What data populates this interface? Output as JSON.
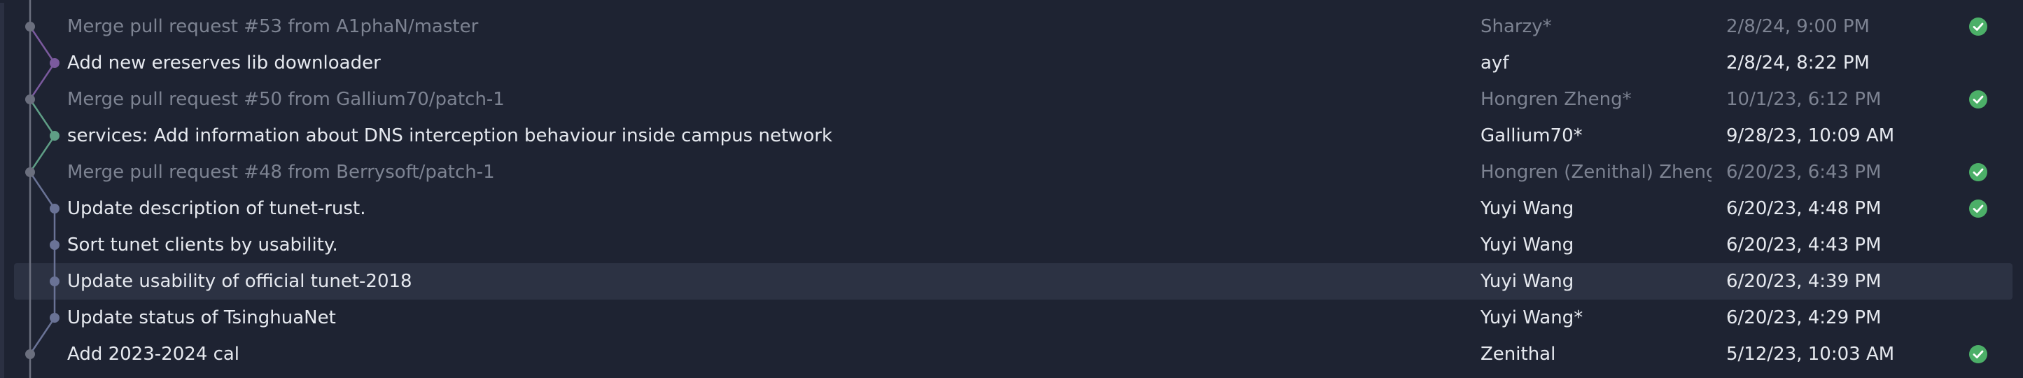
{
  "commits": [
    {
      "message": "Merge pull request #53 from A1phaN/master",
      "author": "Sharzy*",
      "date": "2/8/24, 9:00 PM",
      "status": "success",
      "merge": true
    },
    {
      "message": "Add new ereserves lib downloader",
      "author": "ayf",
      "date": "2/8/24, 8:22 PM",
      "status": "none",
      "merge": false
    },
    {
      "message": "Merge pull request #50 from Gallium70/patch-1",
      "author": "Hongren Zheng*",
      "date": "10/1/23, 6:12 PM",
      "status": "success",
      "merge": true
    },
    {
      "message": "services: Add information about DNS interception behaviour inside campus network",
      "author": "Gallium70*",
      "date": "9/28/23, 10:09 AM",
      "status": "none",
      "merge": false
    },
    {
      "message": "Merge pull request #48 from Berrysoft/patch-1",
      "author": "Hongren (Zenithal) Zheng*",
      "date": "6/20/23, 6:43 PM",
      "status": "success",
      "merge": true
    },
    {
      "message": "Update description of tunet-rust.",
      "author": "Yuyi Wang",
      "date": "6/20/23, 4:48 PM",
      "status": "success",
      "merge": false
    },
    {
      "message": "Sort tunet clients by usability.",
      "author": "Yuyi Wang",
      "date": "6/20/23, 4:43 PM",
      "status": "none",
      "merge": false
    },
    {
      "message": "Update usability of official tunet-2018",
      "author": "Yuyi Wang",
      "date": "6/20/23, 4:39 PM",
      "status": "none",
      "merge": false,
      "selected": true
    },
    {
      "message": "Update status of TsinghuaNet",
      "author": "Yuyi Wang*",
      "date": "6/20/23, 4:29 PM",
      "status": "none",
      "merge": false
    },
    {
      "message": "Add 2023-2024 cal",
      "author": "Zenithal",
      "date": "5/12/23, 10:03 AM",
      "status": "success",
      "merge": false
    }
  ],
  "colors": {
    "background": "#1e2332",
    "selected_row": "#2c3243",
    "text": "#e6e9ef",
    "text_merge": "#7d8392",
    "success": "#4caf68",
    "graph_main": "#6b6f7e",
    "graph_purple": "#7b5a9e",
    "graph_green": "#5f9e86",
    "graph_blue": "#6a7396"
  },
  "icons": {
    "status_success": "check-circle-icon",
    "commit_node": "commit-dot-icon"
  }
}
